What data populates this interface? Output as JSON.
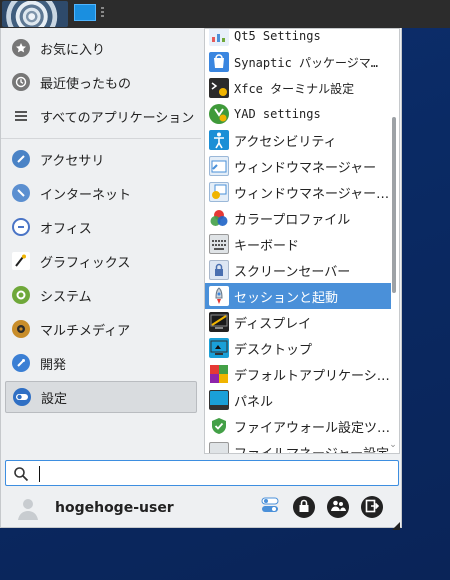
{
  "sidebar": {
    "items": [
      {
        "label": "お気に入り",
        "icon": "star-icon"
      },
      {
        "label": "最近使ったもの",
        "icon": "clock-icon"
      },
      {
        "label": "すべてのアプリケーション",
        "icon": "list-icon"
      },
      {
        "label": "アクセサリ",
        "icon": "accessories-icon"
      },
      {
        "label": "インターネット",
        "icon": "globe-icon"
      },
      {
        "label": "オフィス",
        "icon": "office-icon"
      },
      {
        "label": "グラフィックス",
        "icon": "brush-icon"
      },
      {
        "label": "システム",
        "icon": "gear-icon"
      },
      {
        "label": "マルチメディア",
        "icon": "speaker-icon"
      },
      {
        "label": "開発",
        "icon": "wrench-icon"
      },
      {
        "label": "設定",
        "icon": "toggle-icon"
      }
    ],
    "selected": "設定"
  },
  "apps": [
    {
      "label": "Qt5 Settings",
      "icon": "qt5-settings-icon"
    },
    {
      "label": "Synaptic パッケージマ…",
      "icon": "synaptic-icon"
    },
    {
      "label": "Xfce ターミナル設定",
      "icon": "terminal-settings-icon"
    },
    {
      "label": "YAD settings",
      "icon": "yad-icon"
    },
    {
      "label": "アクセシビリティ",
      "icon": "accessibility-icon"
    },
    {
      "label": "ウィンドウマネージャー",
      "icon": "window-manager-icon"
    },
    {
      "label": "ウィンドウマネージャー…",
      "icon": "window-manager-tweaks-icon"
    },
    {
      "label": "カラープロファイル",
      "icon": "color-profile-icon"
    },
    {
      "label": "キーボード",
      "icon": "keyboard-icon"
    },
    {
      "label": "スクリーンセーバー",
      "icon": "screensaver-icon"
    },
    {
      "label": "セッションと起動",
      "icon": "rocket-icon"
    },
    {
      "label": "ディスプレイ",
      "icon": "display-icon"
    },
    {
      "label": "デスクトップ",
      "icon": "desktop-icon"
    },
    {
      "label": "デフォルトアプリケーシ…",
      "icon": "default-apps-icon"
    },
    {
      "label": "パネル",
      "icon": "panel-icon"
    },
    {
      "label": "ファイアウォール設定ツ…",
      "icon": "firewall-icon"
    },
    {
      "label": "ファイルマネージャー設定",
      "icon": "file-manager-icon"
    }
  ],
  "selected_app": "セッションと起動",
  "search": {
    "value": "",
    "placeholder": ""
  },
  "user": {
    "name": "hogehoge-user"
  },
  "actions": [
    "settings-toggle-icon",
    "lock-icon",
    "switch-user-icon",
    "logout-icon"
  ],
  "colors": {
    "accent": "#4a90d9",
    "panel": "#2c2c2c",
    "desktop": "#0b2a60"
  }
}
